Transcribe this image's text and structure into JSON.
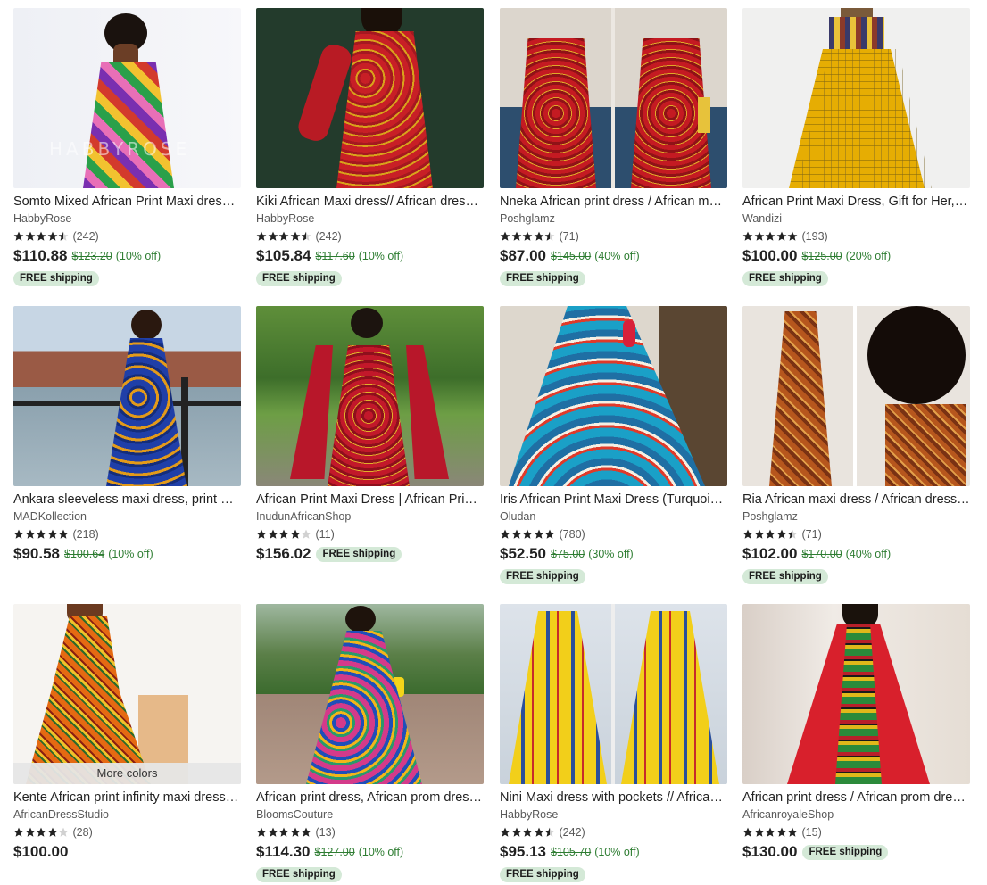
{
  "listings": [
    {
      "title": "Somto Mixed African Print Maxi dress, African dress",
      "shop": "HabbyRose",
      "rating": 4.5,
      "reviews": "(242)",
      "price": "$110.88",
      "original_price": "$123.20",
      "discount": "(10% off)",
      "free_shipping": "FREE shipping",
      "ship_inline": false,
      "watermark": "HABBYROSE",
      "more_colors": "",
      "image": "photo of model in multicolour patchwork african print maxi dress"
    },
    {
      "title": "Kiki African Maxi dress// African dress// African clothing",
      "shop": "HabbyRose",
      "rating": 4.5,
      "reviews": "(242)",
      "price": "$105.84",
      "original_price": "$117.60",
      "discount": "(10% off)",
      "free_shipping": "FREE shipping",
      "ship_inline": false,
      "watermark": "",
      "more_colors": "",
      "image": "photo of model in red long sleeve african maxi dress on dark green backdrop"
    },
    {
      "title": "Nneka African print dress / African maxi dress",
      "shop": "Poshglamz",
      "rating": 4.5,
      "reviews": "(71)",
      "price": "$87.00",
      "original_price": "$145.00",
      "discount": "(40% off)",
      "free_shipping": "FREE shipping",
      "ship_inline": false,
      "watermark": "",
      "more_colors": "",
      "image": "two photos side by side of red off-shoulder african print dress"
    },
    {
      "title": "African Print Maxi Dress, Gift for Her, African clothing",
      "shop": "Wandizi",
      "rating": 5,
      "reviews": "(193)",
      "price": "$100.00",
      "original_price": "$125.00",
      "discount": "(20% off)",
      "free_shipping": "FREE shipping",
      "ship_inline": false,
      "watermark": "",
      "more_colors": "",
      "image": "photo of yellow checked african print maxi dress"
    },
    {
      "title": "Ankara sleeveless maxi dress, print maxi dress",
      "shop": "MADKollection",
      "rating": 5,
      "reviews": "(218)",
      "price": "$90.58",
      "original_price": "$100.64",
      "discount": "(10% off)",
      "free_shipping": "",
      "ship_inline": false,
      "watermark": "",
      "more_colors": "",
      "image": "photo of model in blue ankara maxi dress by a river"
    },
    {
      "title": "African Print Maxi Dress | African Print Clothing",
      "shop": "InudunAfricanShop",
      "rating": 4,
      "reviews": "(11)",
      "price": "$156.02",
      "original_price": "",
      "discount": "",
      "free_shipping": "FREE shipping",
      "ship_inline": true,
      "watermark": "",
      "more_colors": "",
      "image": "photo of model in red maxi dress with long bell sleeves in garden"
    },
    {
      "title": "Iris African Print Maxi Dress (Turquoise)",
      "shop": "Oludan",
      "rating": 5,
      "reviews": "(780)",
      "price": "$52.50",
      "original_price": "$75.00",
      "discount": "(30% off)",
      "free_shipping": "FREE shipping",
      "ship_inline": false,
      "watermark": "",
      "more_colors": "",
      "image": "photo of turquoise and red wave print maxi dress"
    },
    {
      "title": "Ria African maxi dress / African dress / Ankara",
      "shop": "Poshglamz",
      "rating": 4.5,
      "reviews": "(71)",
      "price": "$102.00",
      "original_price": "$170.00",
      "discount": "(40% off)",
      "free_shipping": "FREE shipping",
      "ship_inline": false,
      "watermark": "",
      "more_colors": "",
      "image": "two photos of orange strapless african print maxi dress"
    },
    {
      "title": "Kente African print infinity maxi dress, African",
      "shop": "AfricanDressStudio",
      "rating": 4,
      "reviews": "(28)",
      "price": "$100.00",
      "original_price": "",
      "discount": "",
      "free_shipping": "",
      "ship_inline": false,
      "watermark": "",
      "more_colors": "More colors",
      "image": "photo of model in orange kente print infinity maxi dress"
    },
    {
      "title": "African print dress, African prom dress, Ankara",
      "shop": "BloomsCouture",
      "rating": 5,
      "reviews": "(13)",
      "price": "$114.30",
      "original_price": "$127.00",
      "discount": "(10% off)",
      "free_shipping": "FREE shipping",
      "ship_inline": false,
      "watermark": "",
      "more_colors": "",
      "image": "photo of model in colourful floral print gown in a park"
    },
    {
      "title": "Nini Maxi dress with pockets // African print dress",
      "shop": "HabbyRose",
      "rating": 4.5,
      "reviews": "(242)",
      "price": "$95.13",
      "original_price": "$105.70",
      "discount": "(10% off)",
      "free_shipping": "FREE shipping",
      "ship_inline": false,
      "watermark": "",
      "more_colors": "",
      "image": "two photos of yellow and blue print maxi dress with pockets"
    },
    {
      "title": "African print dress / African prom dress / Ankara",
      "shop": "AfricanroyaleShop",
      "rating": 5,
      "reviews": "(15)",
      "price": "$130.00",
      "original_price": "",
      "discount": "",
      "free_shipping": "FREE shipping",
      "ship_inline": true,
      "watermark": "",
      "more_colors": "",
      "image": "photo of model in red gown with dashiki panel"
    }
  ],
  "colors": {
    "star": "#222222",
    "star_empty": "#d1d1d1",
    "discount_green": "#2e7d32",
    "badge_bg": "#d4e9d7"
  }
}
